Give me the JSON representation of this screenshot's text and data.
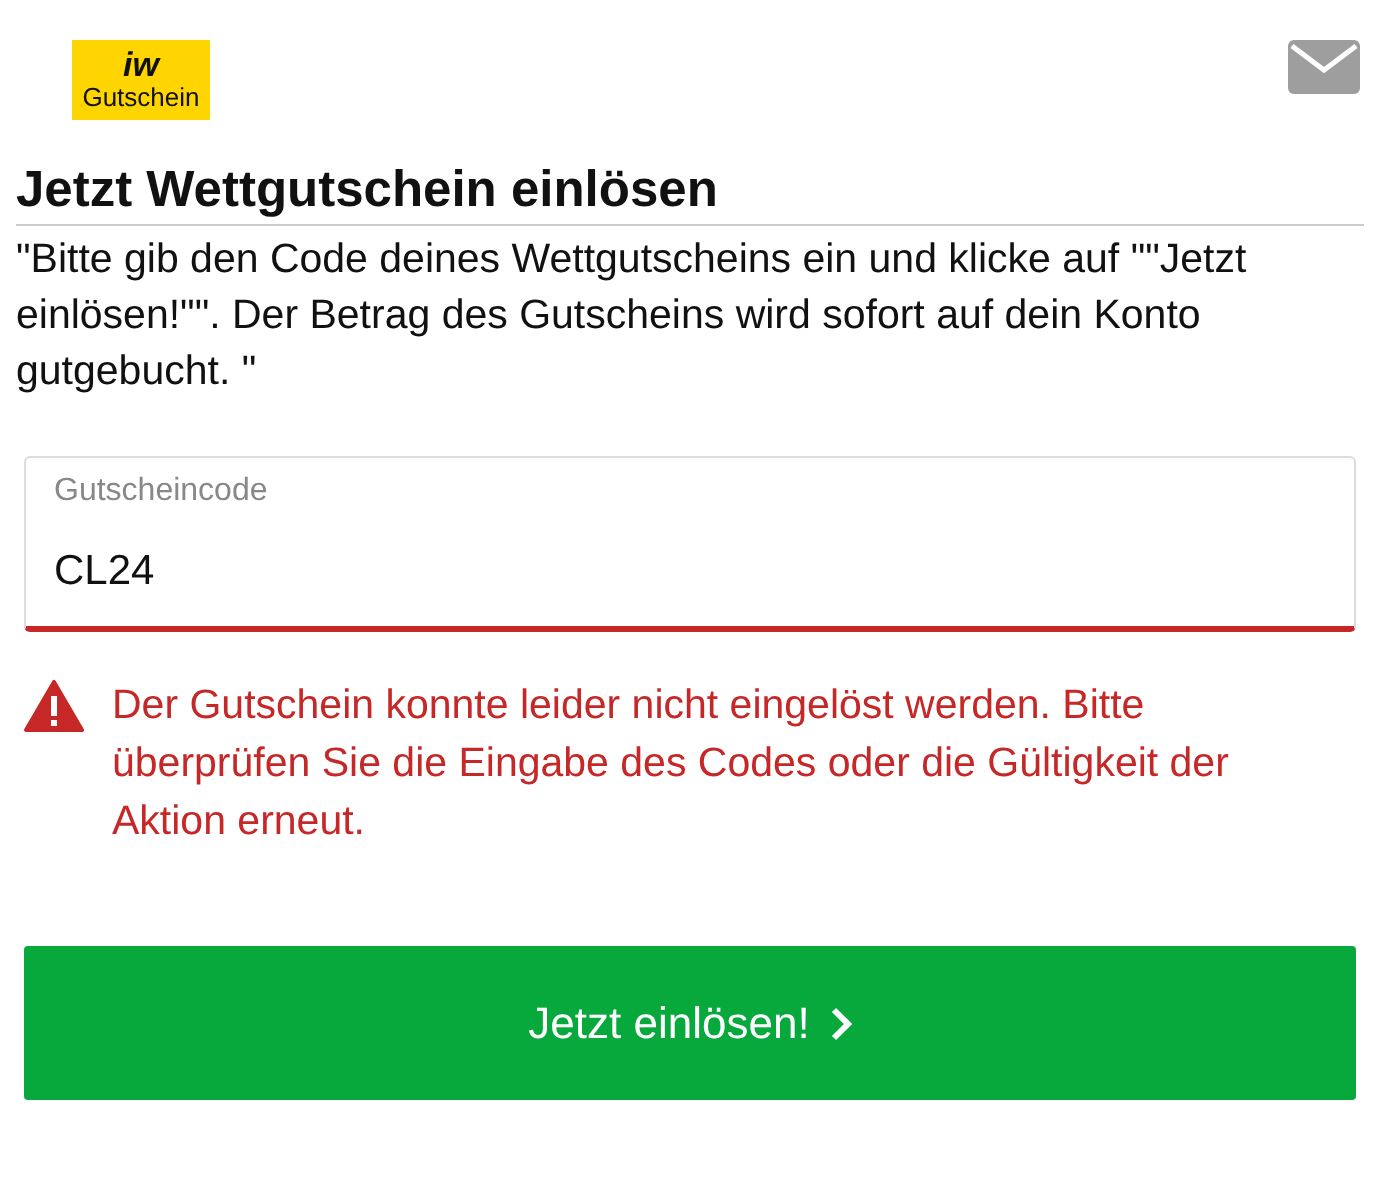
{
  "header": {
    "logo": {
      "top": "iw",
      "bottom": "Gutschein"
    }
  },
  "title": "Jetzt Wettgutschein einlösen",
  "intro": "\"Bitte gib den Code deines Wettgutscheins ein und klicke auf \"\"Jetzt einlösen!\"\". Der Betrag des Gutscheins wird sofort auf dein Konto gutgebucht. \"",
  "field": {
    "label": "Gutscheincode",
    "value": "CL24",
    "invalid": true
  },
  "error": "Der Gutschein konnte leider nicht eingelöst werden. Bitte überprüfen Sie die Eingabe des Codes oder die Gültigkeit der Aktion erneut.",
  "button": {
    "label": "Jetzt einlösen!"
  }
}
